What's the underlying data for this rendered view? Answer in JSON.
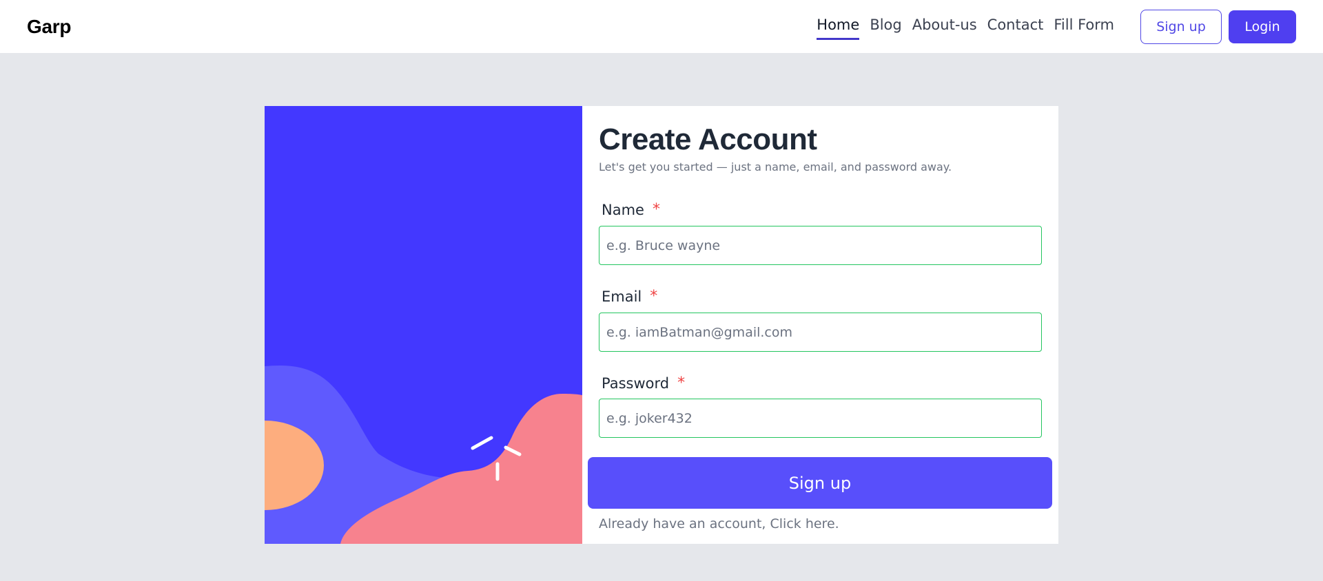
{
  "brand": "Garp",
  "nav": {
    "links": [
      "Home",
      "Blog",
      "About-us",
      "Contact",
      "Fill Form"
    ],
    "active": "Home",
    "signup_label": "Sign up",
    "login_label": "Login"
  },
  "form": {
    "title": "Create Account",
    "subtitle": "Let's get you started — just a name, email, and password away.",
    "required_marker": "*",
    "fields": [
      {
        "label": "Name",
        "placeholder": "e.g. Bruce wayne",
        "value": ""
      },
      {
        "label": "Email",
        "placeholder": "e.g. iamBatman@gmail.com",
        "value": ""
      },
      {
        "label": "Password",
        "placeholder": "e.g. joker432",
        "value": ""
      }
    ],
    "submit_label": "Sign up",
    "signin_text": "Already have an account, Click here."
  },
  "colors": {
    "accent": "#4f3ff0",
    "illustration_bg": "#4338ff",
    "field_border": "#22c55e",
    "required": "#ef4444",
    "page_bg": "#e5e7eb"
  },
  "icons": {
    "illustration": "abstract-blob-illustration"
  }
}
